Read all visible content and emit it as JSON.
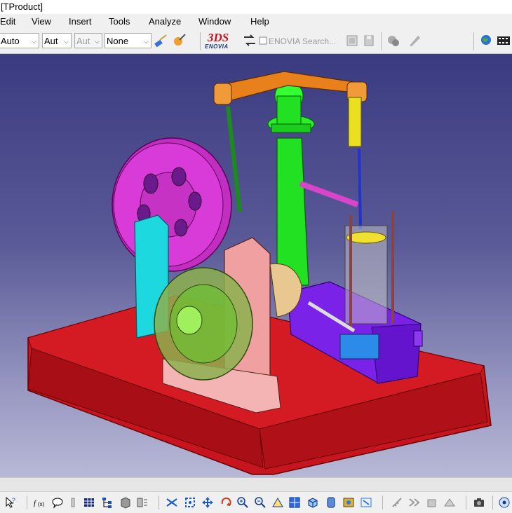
{
  "window": {
    "title": "[TProduct]"
  },
  "menu": {
    "items": [
      {
        "label": "Edit",
        "accel": "E"
      },
      {
        "label": "View",
        "accel": "V"
      },
      {
        "label": "Insert",
        "accel": "I"
      },
      {
        "label": "Tools",
        "accel": "T"
      },
      {
        "label": "Analyze",
        "accel": "A"
      },
      {
        "label": "Window",
        "accel": "W"
      },
      {
        "label": "Help",
        "accel": "H"
      }
    ]
  },
  "toolbar": {
    "color_combo": "Auto",
    "line_type_combo": "Aut",
    "line_weight_combo": "Aut",
    "layer_combo": "None",
    "enovia_search_label": "ENOVIA Search...",
    "ds_logo_text": "3DS",
    "enovia_logo_text": "ENOVIA"
  },
  "viewport": {
    "scene": "steam-engine-assembly"
  },
  "colors": {
    "base_plate": "#c8141e",
    "flywheel": "#d93bd8",
    "column": "#22e022",
    "beam": "#e8801c",
    "cylinder_block": "#7a22e8",
    "bearing_housing": "#f0a0a0",
    "support_bracket": "#1ed8e0",
    "background_top": "#3a3a80",
    "background_bottom": "#b8b8d6"
  }
}
